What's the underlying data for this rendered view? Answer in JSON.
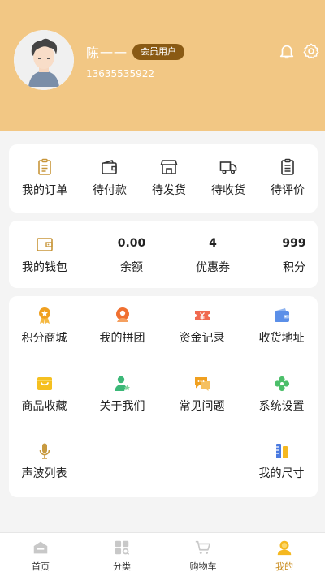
{
  "profile": {
    "name": "陈一一",
    "badge": "会员用户",
    "phone": "13635535922"
  },
  "header_icons": [
    "bell-icon",
    "gear-icon"
  ],
  "orders": [
    {
      "label": "我的订单",
      "icon": "clipboard-icon"
    },
    {
      "label": "待付款",
      "icon": "wallet-icon"
    },
    {
      "label": "待发货",
      "icon": "shop-icon"
    },
    {
      "label": "待收货",
      "icon": "truck-icon"
    },
    {
      "label": "待评价",
      "icon": "review-icon"
    }
  ],
  "wallet": {
    "label": "我的钱包",
    "icon": "purse-icon",
    "balance": {
      "value": "0.00",
      "label": "余额"
    },
    "coupons": {
      "value": "4",
      "label": "优惠券"
    },
    "points": {
      "value": "999",
      "label": "积分"
    }
  },
  "services": [
    {
      "label": "积分商城",
      "icon": "medal-icon",
      "color": "#f0a020"
    },
    {
      "label": "我的拼团",
      "icon": "group-icon",
      "color": "#f07030"
    },
    {
      "label": "资金记录",
      "icon": "ticket-icon",
      "color": "#f06a50"
    },
    {
      "label": "收货地址",
      "icon": "wallet-blue-icon",
      "color": "#5b8fe8"
    },
    {
      "label": "商品收藏",
      "icon": "favorite-box-icon",
      "color": "#f5c020"
    },
    {
      "label": "关于我们",
      "icon": "user-star-icon",
      "color": "#3cb878"
    },
    {
      "label": "常见问题",
      "icon": "chat-icon",
      "color": "#f0a020"
    },
    {
      "label": "系统设置",
      "icon": "settings-flower-icon",
      "color": "#4cbf6a"
    },
    {
      "label": "声波列表",
      "icon": "microphone-icon",
      "color": "#c89a40"
    },
    {
      "label": "我的尺寸",
      "icon": "ruler-icon",
      "color": "#4a7ae0"
    }
  ],
  "tabs": [
    {
      "label": "首页",
      "icon": "home-icon",
      "active": false
    },
    {
      "label": "分类",
      "icon": "category-icon",
      "active": false
    },
    {
      "label": "购物车",
      "icon": "cart-icon",
      "active": false
    },
    {
      "label": "我的",
      "icon": "profile-icon",
      "active": true
    }
  ],
  "colors": {
    "header_bg": "#f2c784",
    "badge_bg": "#8a5a14",
    "accent": "#c88a1a"
  }
}
